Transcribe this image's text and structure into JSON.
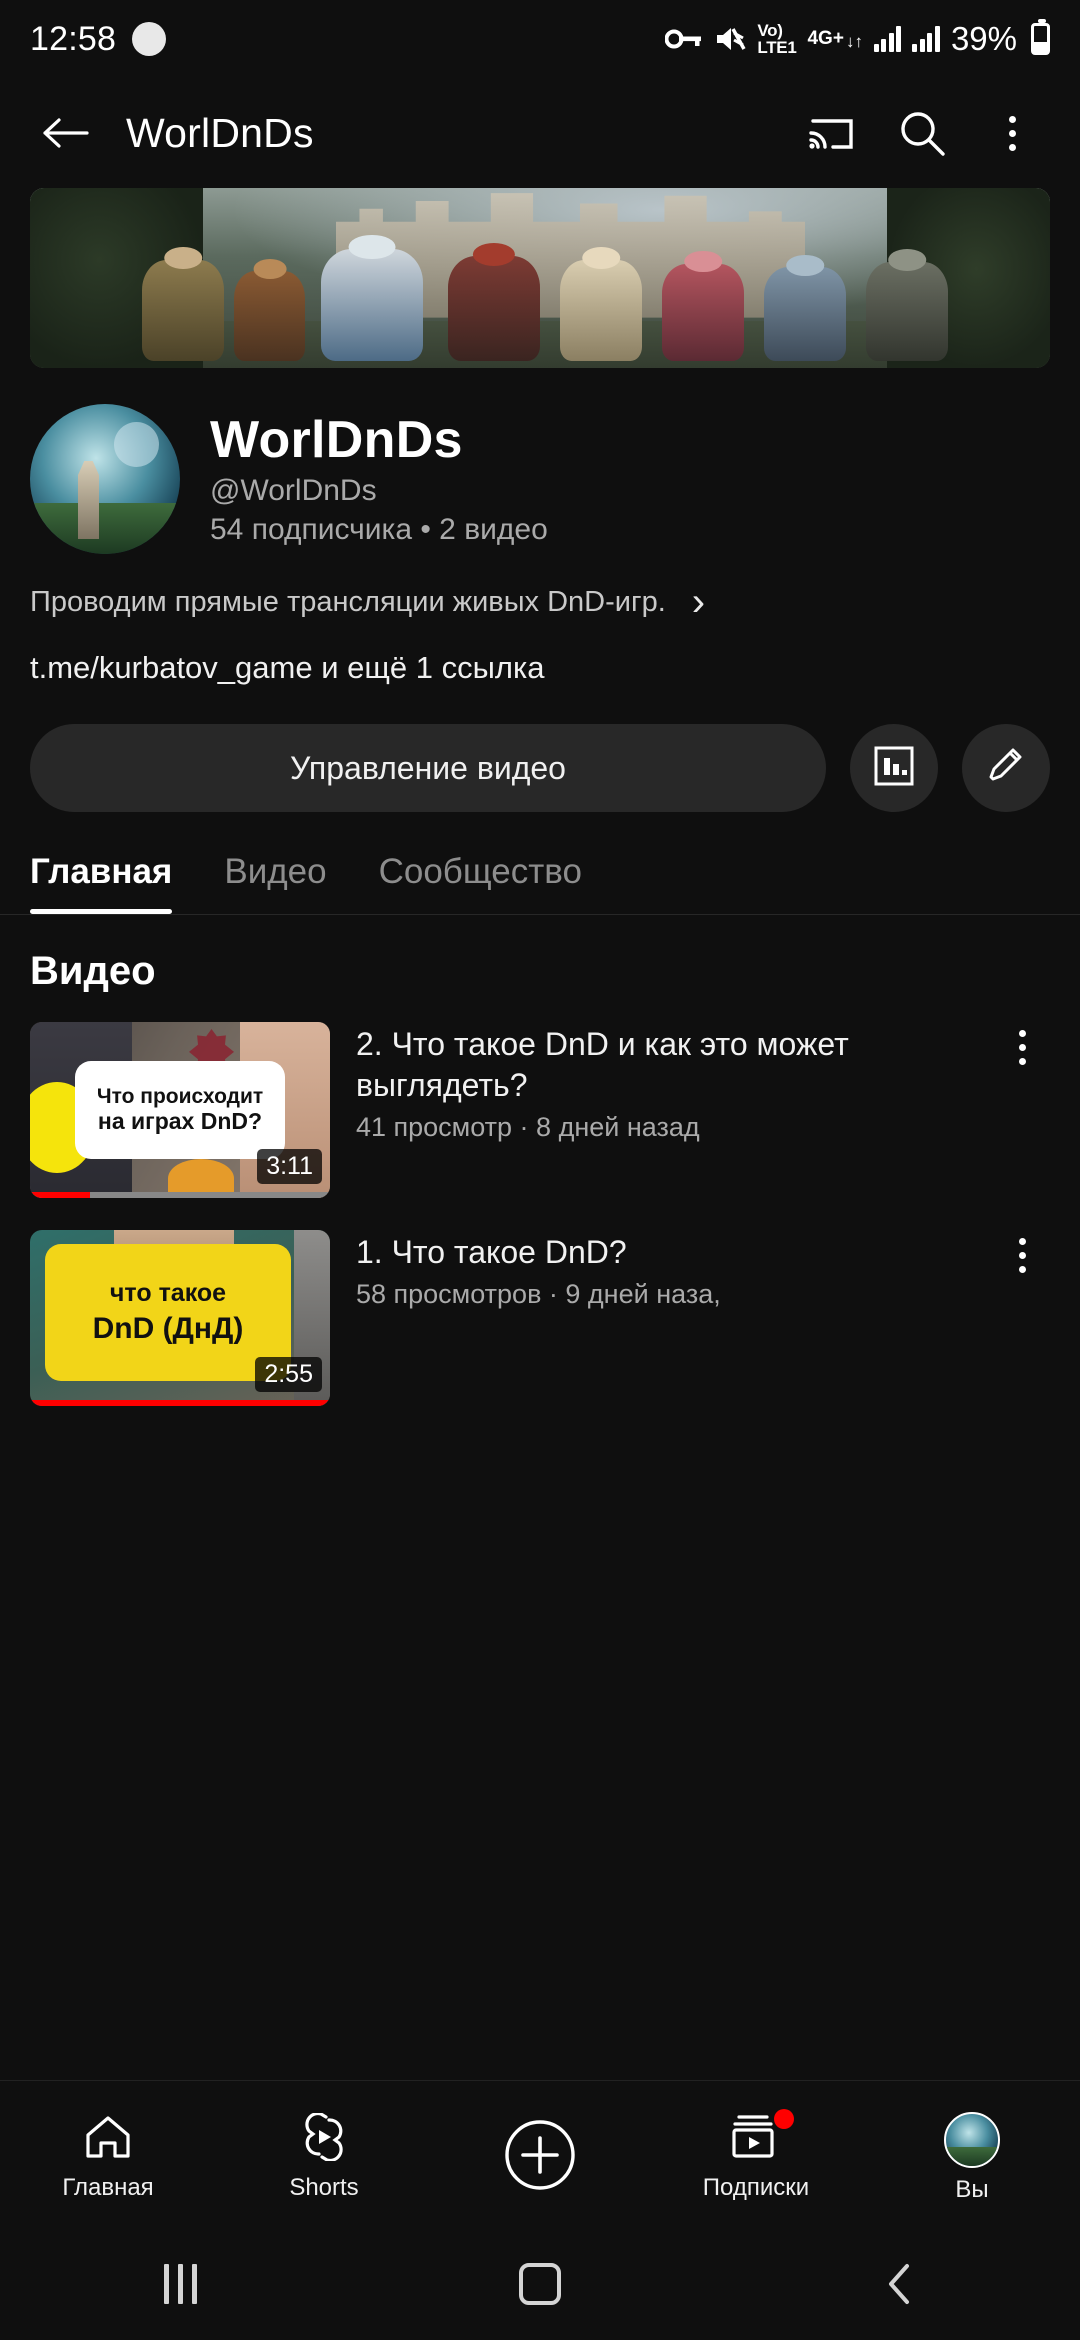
{
  "status_bar": {
    "time": "12:58",
    "vpn_icon": "key-icon",
    "mute_icon": "speaker-mute-icon",
    "volte_line1": "Vo)",
    "volte_line2": "LTE1",
    "network_label": "4G+",
    "network_arrows": "↓↑",
    "battery_percent": "39%"
  },
  "app_bar": {
    "back_icon": "back-arrow-icon",
    "title": "WorlDnDs",
    "cast_icon": "cast-icon",
    "search_icon": "search-icon",
    "more_icon": "more-vertical-icon"
  },
  "channel": {
    "name": "WorlDnDs",
    "handle": "@WorlDnDs",
    "stats": "54 подписчика • 2 видео",
    "description": "Проводим прямые трансляции живых DnD-игр.",
    "description_chevron": "›",
    "links": "t.me/kurbatov_game и ещё 1 ссылка",
    "manage_button": "Управление видео",
    "analytics_icon": "analytics-bar-chart-icon",
    "edit_icon": "pencil-edit-icon"
  },
  "tabs": [
    {
      "label": "Главная",
      "active": true
    },
    {
      "label": "Видео",
      "active": false
    },
    {
      "label": "Сообщество",
      "active": false
    }
  ],
  "videos_section": {
    "heading": "Видео",
    "items": [
      {
        "title": "2. Что такое DnD и как это может выглядеть?",
        "meta": "41 просмотр · 8 дней назад",
        "duration": "3:11",
        "progress_percent": 20,
        "thumbnail_text_line1": "Что происходит",
        "thumbnail_text_line2": "на играх DnD?",
        "menu_icon": "more-vertical-icon"
      },
      {
        "title": "1. Что такое DnD?",
        "meta": "58 просмотров · 9 дней наза,",
        "duration": "2:55",
        "progress_percent": 100,
        "thumbnail_text_line1": "что такое",
        "thumbnail_text_line2": "DnD (ДнД)",
        "menu_icon": "more-vertical-icon"
      }
    ]
  },
  "bottom_nav": [
    {
      "label": "Главная",
      "icon": "home-icon",
      "badge": false
    },
    {
      "label": "Shorts",
      "icon": "shorts-icon",
      "badge": false
    },
    {
      "label": "",
      "icon": "create-plus-icon",
      "badge": false
    },
    {
      "label": "Подписки",
      "icon": "subscriptions-icon",
      "badge": true
    },
    {
      "label": "Вы",
      "icon": "account-avatar-icon",
      "badge": false
    }
  ],
  "system_nav": {
    "recents_icon": "recents-icon",
    "home_icon": "home-square-icon",
    "back_icon": "back-chevron-icon"
  },
  "colors": {
    "background": "#0f0f0f",
    "surface": "#282828",
    "accent_red": "#ff0000",
    "text_primary": "#f1f1f1",
    "text_secondary": "#aaaaaa"
  }
}
